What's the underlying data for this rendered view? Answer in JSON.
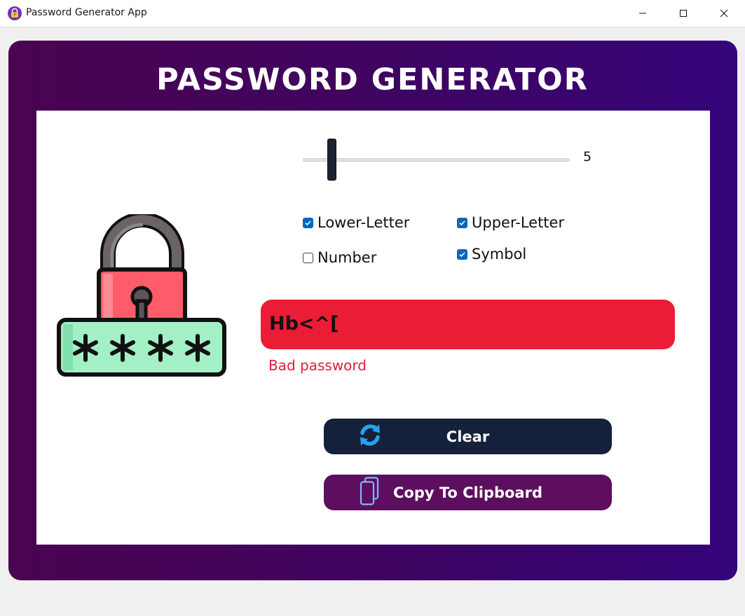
{
  "window": {
    "title": "Password Generator App"
  },
  "header": {
    "title": "PASSWORD GENERATOR"
  },
  "slider": {
    "value": "5"
  },
  "options": [
    {
      "label": "Lower-Letter",
      "checked": true
    },
    {
      "label": "Upper-Letter",
      "checked": true
    },
    {
      "label": "Number",
      "checked": false
    },
    {
      "label": "Symbol",
      "checked": true
    }
  ],
  "password": {
    "value": "Hb<^[",
    "strength_text": "Bad password"
  },
  "buttons": {
    "clear_label": "Clear",
    "copy_label": "Copy To Clipboard"
  },
  "icons": {
    "app": "lock-icon",
    "illustration": "padlock-password-icon",
    "clear": "refresh-icon",
    "copy": "clipboard-icon"
  },
  "colors": {
    "panel_gradient_start": "#4a0450",
    "panel_gradient_end": "#34047a",
    "password_bg": "#eb1c36",
    "strength_text": "#e31b3c",
    "clear_button": "#15203a",
    "copy_button": "#5d0e5f",
    "checkbox_checked": "#0067c0"
  }
}
